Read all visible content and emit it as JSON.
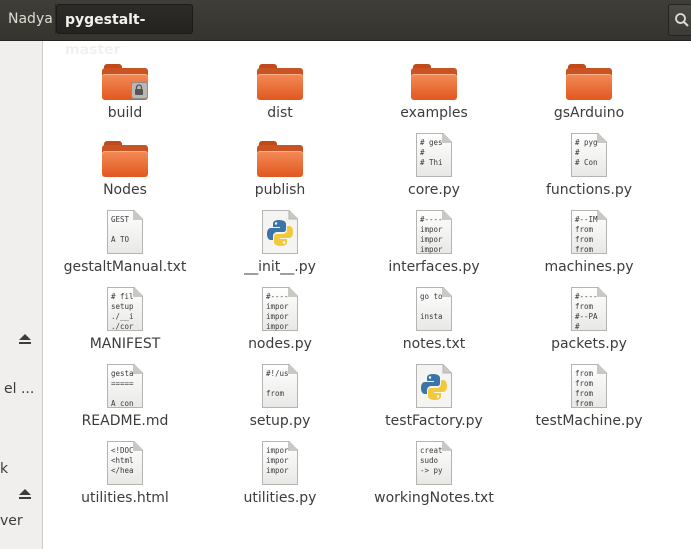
{
  "window": {
    "breadcrumb_parent": "Nadya",
    "breadcrumb_current": "pygestalt-master"
  },
  "sidebar": {
    "items": [
      {
        "label": "el ...",
        "has_eject": false
      },
      {
        "label": "k",
        "has_eject": true
      },
      {
        "label": "ver",
        "has_eject": false
      }
    ]
  },
  "files": [
    {
      "name": "build",
      "type": "folder",
      "locked": true
    },
    {
      "name": "dist",
      "type": "folder",
      "locked": false
    },
    {
      "name": "examples",
      "type": "folder",
      "locked": false
    },
    {
      "name": "gsArduino",
      "type": "folder",
      "locked": false
    },
    {
      "name": "Nodes",
      "type": "folder",
      "locked": false
    },
    {
      "name": "publish",
      "type": "folder",
      "locked": false
    },
    {
      "name": "core.py",
      "type": "text",
      "preview": "# ges\n#\n# Thi"
    },
    {
      "name": "functions.py",
      "type": "text",
      "preview": "# pyg\n#\n# Con"
    },
    {
      "name": "gestaltManual.txt",
      "type": "text",
      "preview": "GEST\n\nA TO"
    },
    {
      "name": "__init__.py",
      "type": "python"
    },
    {
      "name": "interfaces.py",
      "type": "text",
      "preview": "#----\nimpor\nimpor\nimpor"
    },
    {
      "name": "machines.py",
      "type": "text",
      "preview": "#--IM\nfrom\nfrom\nfrom"
    },
    {
      "name": "MANIFEST",
      "type": "text",
      "preview": "# fil\nsetup\n./__i\n./cor"
    },
    {
      "name": "nodes.py",
      "type": "text",
      "preview": "#----\nimpor\nimpor\nimpor"
    },
    {
      "name": "notes.txt",
      "type": "text",
      "preview": "go to\n\ninsta"
    },
    {
      "name": "packets.py",
      "type": "text",
      "preview": "#----\nfrom\n#--PA\n#"
    },
    {
      "name": "README.md",
      "type": "text",
      "preview": "gesta\n=====\n\nA con"
    },
    {
      "name": "setup.py",
      "type": "text",
      "preview": "#!/us\n\nfrom"
    },
    {
      "name": "testFactory.py",
      "type": "python"
    },
    {
      "name": "testMachine.py",
      "type": "text",
      "preview": "from\nfrom\nfrom\nfrom"
    },
    {
      "name": "utilities.html",
      "type": "text",
      "preview": "<!DOC\n<html\n</hea"
    },
    {
      "name": "utilities.py",
      "type": "text",
      "preview": "impor\nimpor\nimpor"
    },
    {
      "name": "workingNotes.txt",
      "type": "text",
      "preview": "creat\nsudo\n-> py"
    }
  ],
  "icons": {
    "folder": "folder-icon",
    "text": "text-file-icon",
    "python": "python-file-icon",
    "lock": "lock-icon",
    "eject": "eject-icon",
    "search": "search-icon"
  },
  "colors": {
    "header_bg": "#3c3b37",
    "folder_orange": "#ec6a34",
    "sidebar_bg": "#f0efed"
  }
}
